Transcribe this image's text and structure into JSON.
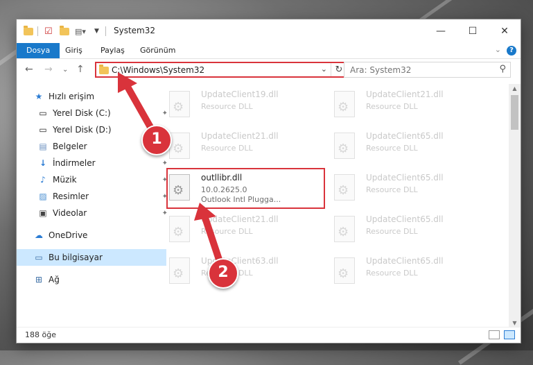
{
  "window": {
    "title": "System32",
    "minimize_label": "—",
    "maximize_label": "☐",
    "close_label": "✕"
  },
  "ribbon": {
    "tabs": [
      {
        "label": "Dosya"
      },
      {
        "label": "Giriş"
      },
      {
        "label": "Paylaş"
      },
      {
        "label": "Görünüm"
      }
    ],
    "help": "?"
  },
  "address": {
    "path": "C:\\Windows\\System32",
    "refresh": "↻",
    "dropdown": "⌄"
  },
  "search": {
    "placeholder": "Ara: System32"
  },
  "sidebar": {
    "items": [
      {
        "label": "Hızlı erişim",
        "icon": "star-icon"
      },
      {
        "label": "Yerel Disk (C:)",
        "icon": "drive-icon"
      },
      {
        "label": "Yerel Disk (D:)",
        "icon": "drive-icon"
      },
      {
        "label": "Belgeler",
        "icon": "documents-icon"
      },
      {
        "label": "İndirmeler",
        "icon": "download-icon"
      },
      {
        "label": "Müzik",
        "icon": "music-icon"
      },
      {
        "label": "Resimler",
        "icon": "pictures-icon"
      },
      {
        "label": "Videolar",
        "icon": "videos-icon"
      },
      {
        "label": "OneDrive",
        "icon": "cloud-icon"
      },
      {
        "label": "Bu bilgisayar",
        "icon": "computer-icon"
      },
      {
        "label": "Ağ",
        "icon": "network-icon"
      }
    ]
  },
  "files": [
    {
      "name": "UpdateClient19.dll",
      "desc": "Resource DLL"
    },
    {
      "name": "UpdateClient21.dll",
      "desc": "Resource DLL"
    },
    {
      "name": "UpdateClient21.dll",
      "desc": "Resource DLL"
    },
    {
      "name": "UpdateClient65.dll",
      "desc": "Resource DLL"
    },
    {
      "name": "outllibr.dll",
      "version": "10.0.2625.0",
      "desc": "Outlook Intl Plugga..."
    },
    {
      "name": "UpdateClient65.dll",
      "desc": "Resource DLL"
    },
    {
      "name": "UpdateClient21.dll",
      "desc": "Resource DLL"
    },
    {
      "name": "UpdateClient65.dll",
      "desc": "Resource DLL"
    },
    {
      "name": "UpdateClient63.dll",
      "desc": "Resource DLL"
    },
    {
      "name": "UpdateClient65.dll",
      "desc": "Resource DLL"
    }
  ],
  "status": {
    "count": "188 öğe"
  },
  "annotations": {
    "step1": "1",
    "step2": "2"
  },
  "colors": {
    "accent": "#1979ca",
    "highlight": "#d9333b",
    "selected": "#cce8ff"
  }
}
